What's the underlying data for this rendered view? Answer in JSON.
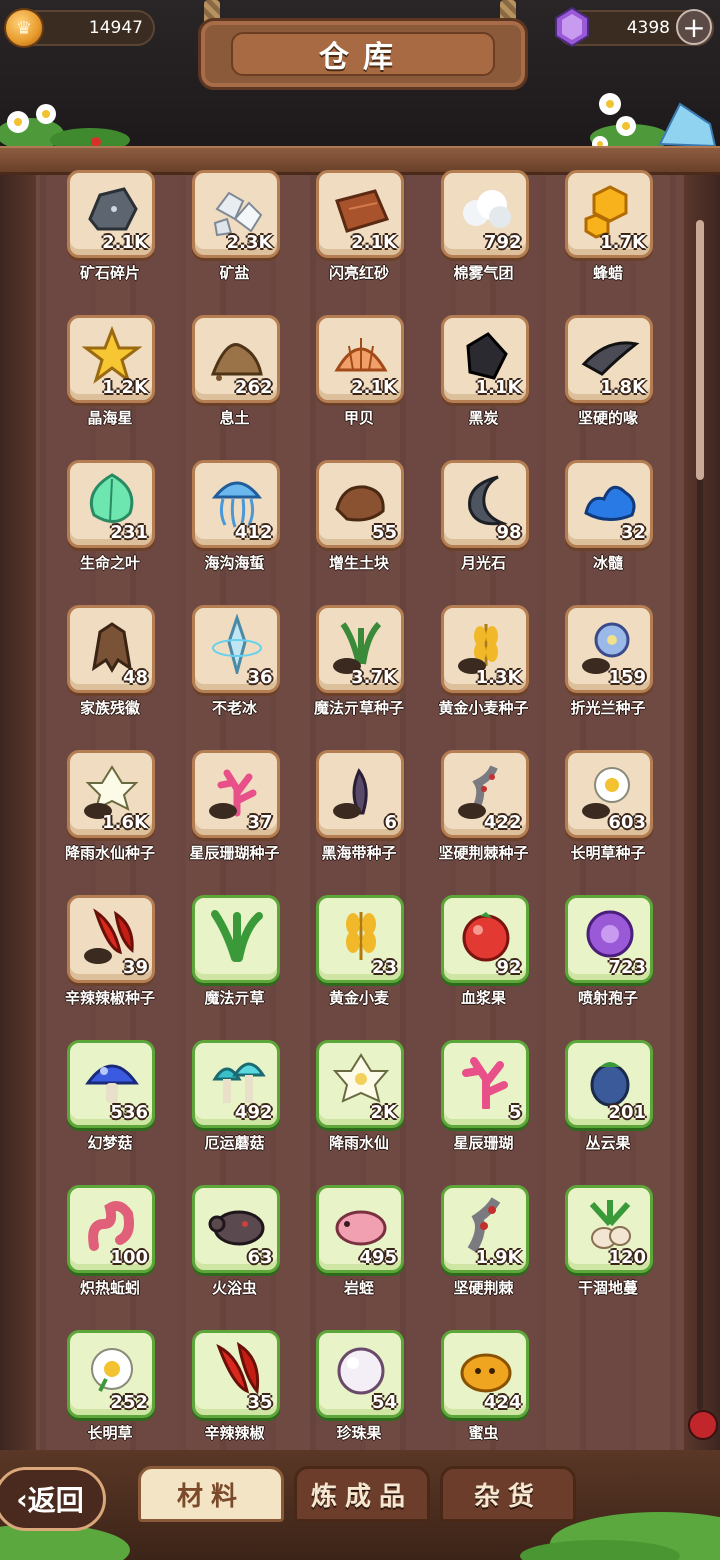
{
  "header": {
    "title": "仓库",
    "coins": "14947",
    "gems": "4398",
    "plus_label": "+"
  },
  "items": [
    {
      "name": "矿石碎片",
      "count": "2.1K",
      "frame": "brown",
      "icon": "ore-chunk"
    },
    {
      "name": "矿盐",
      "count": "2.3K",
      "frame": "brown",
      "icon": "salt-crystals"
    },
    {
      "name": "闪亮红砂",
      "count": "2.1K",
      "frame": "brown",
      "icon": "red-sand-brick"
    },
    {
      "name": "棉雾气团",
      "count": "792",
      "frame": "brown",
      "icon": "cloud-puff"
    },
    {
      "name": "蜂蜡",
      "count": "1.7K",
      "frame": "brown",
      "icon": "honeycomb"
    },
    {
      "name": "晶海星",
      "count": "1.2K",
      "frame": "brown",
      "icon": "star"
    },
    {
      "name": "息土",
      "count": "262",
      "frame": "brown",
      "icon": "soil-pile"
    },
    {
      "name": "甲贝",
      "count": "2.1K",
      "frame": "brown",
      "icon": "shell"
    },
    {
      "name": "黑炭",
      "count": "1.1K",
      "frame": "brown",
      "icon": "charcoal"
    },
    {
      "name": "坚硬的喙",
      "count": "1.8K",
      "frame": "brown",
      "icon": "beak"
    },
    {
      "name": "生命之叶",
      "count": "231",
      "frame": "brown",
      "icon": "life-leaf"
    },
    {
      "name": "海沟海蜇",
      "count": "412",
      "frame": "brown",
      "icon": "jellyfish"
    },
    {
      "name": "增生土块",
      "count": "55",
      "frame": "brown",
      "icon": "dirt-clod"
    },
    {
      "name": "月光石",
      "count": "98",
      "frame": "brown",
      "icon": "moonstone"
    },
    {
      "name": "冰髓",
      "count": "32",
      "frame": "brown",
      "icon": "ice-slime"
    },
    {
      "name": "家族残徽",
      "count": "48",
      "frame": "brown",
      "icon": "broken-emblem"
    },
    {
      "name": "不老冰",
      "count": "36",
      "frame": "brown",
      "icon": "ice-shard"
    },
    {
      "name": "魔法亓草种子",
      "count": "3.7K",
      "frame": "brown",
      "icon": "magic-grass-seed"
    },
    {
      "name": "黄金小麦种子",
      "count": "1.3K",
      "frame": "brown",
      "icon": "wheat-seed"
    },
    {
      "name": "折光兰种子",
      "count": "159",
      "frame": "brown",
      "icon": "orchid-seed"
    },
    {
      "name": "降雨水仙种子",
      "count": "1.6K",
      "frame": "brown",
      "icon": "narcissus-seed"
    },
    {
      "name": "星辰珊瑚种子",
      "count": "37",
      "frame": "brown",
      "icon": "coral-seed"
    },
    {
      "name": "黑海带种子",
      "count": "6",
      "frame": "brown",
      "icon": "kelp-seed"
    },
    {
      "name": "坚硬荆棘种子",
      "count": "422",
      "frame": "brown",
      "icon": "thorn-seed"
    },
    {
      "name": "长明草种子",
      "count": "603",
      "frame": "brown",
      "icon": "daisy-seed"
    },
    {
      "name": "辛辣辣椒种子",
      "count": "39",
      "frame": "brown",
      "icon": "pepper-seed"
    },
    {
      "name": "魔法亓草",
      "count": "",
      "frame": "green",
      "icon": "magic-grass"
    },
    {
      "name": "黄金小麦",
      "count": "23",
      "frame": "green",
      "icon": "wheat"
    },
    {
      "name": "血浆果",
      "count": "92",
      "frame": "green",
      "icon": "red-berry"
    },
    {
      "name": "喷射孢子",
      "count": "723",
      "frame": "green",
      "icon": "purple-spore"
    },
    {
      "name": "幻梦菇",
      "count": "536",
      "frame": "green",
      "icon": "blue-mushroom"
    },
    {
      "name": "厄运蘑菇",
      "count": "492",
      "frame": "green",
      "icon": "teal-mushrooms"
    },
    {
      "name": "降雨水仙",
      "count": "2K",
      "frame": "green",
      "icon": "narcissus"
    },
    {
      "name": "星辰珊瑚",
      "count": "5",
      "frame": "green",
      "icon": "coral"
    },
    {
      "name": "丛云果",
      "count": "201",
      "frame": "green",
      "icon": "eggplant"
    },
    {
      "name": "炽热蚯蚓",
      "count": "100",
      "frame": "green",
      "icon": "worm"
    },
    {
      "name": "火浴虫",
      "count": "63",
      "frame": "green",
      "icon": "bug"
    },
    {
      "name": "岩蛭",
      "count": "495",
      "frame": "green",
      "icon": "leech"
    },
    {
      "name": "坚硬荆棘",
      "count": "1.9K",
      "frame": "green",
      "icon": "thorn"
    },
    {
      "name": "干涸地蔓",
      "count": "120",
      "frame": "green",
      "icon": "root-vine"
    },
    {
      "name": "长明草",
      "count": "252",
      "frame": "green",
      "icon": "daisy"
    },
    {
      "name": "辛辣辣椒",
      "count": "35",
      "frame": "green",
      "icon": "chili"
    },
    {
      "name": "珍珠果",
      "count": "54",
      "frame": "green",
      "icon": "pearl"
    },
    {
      "name": "蜜虫",
      "count": "424",
      "frame": "green",
      "icon": "honey-bug"
    }
  ],
  "tabs": [
    {
      "label": "材料",
      "active": true
    },
    {
      "label": "炼成品",
      "active": false
    },
    {
      "label": "杂货",
      "active": false
    }
  ],
  "back_label": "返回"
}
